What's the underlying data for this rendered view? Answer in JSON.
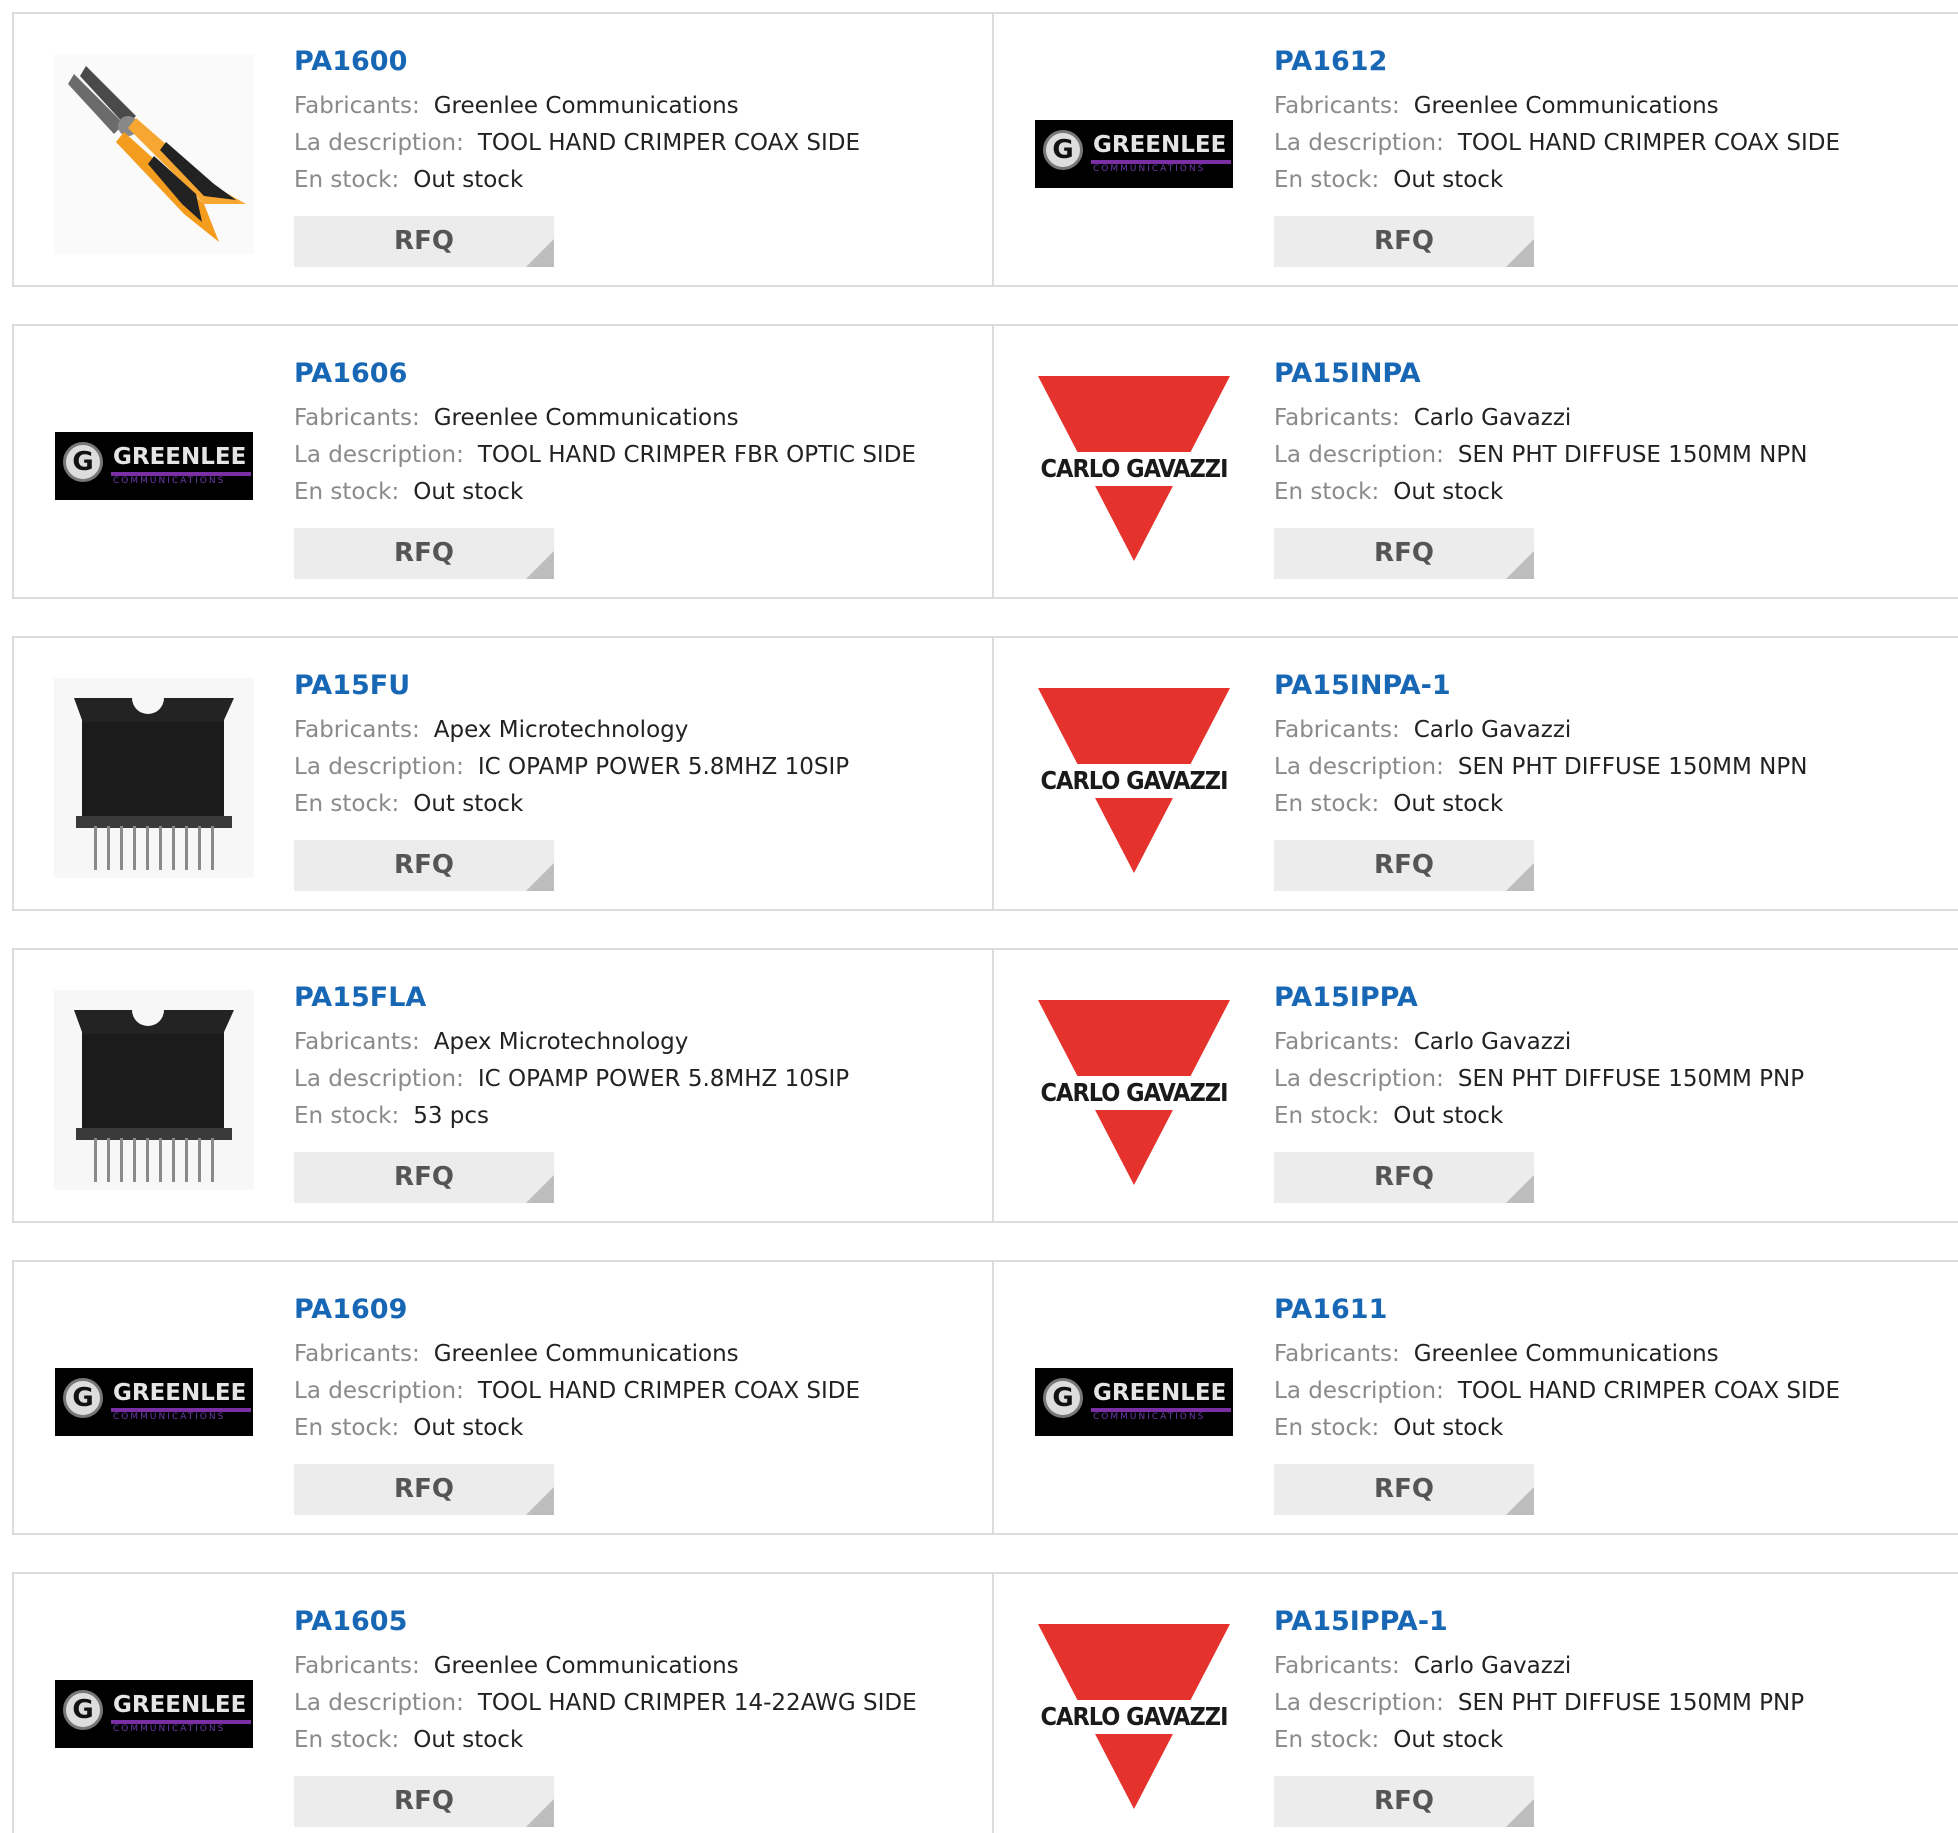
{
  "labels": {
    "manufacturer": "Fabricants:",
    "description": "La description:",
    "stock": "En stock:",
    "rfq": "RFQ"
  },
  "colors": {
    "part_link": "#1767b5",
    "border": "#dcdcdc",
    "rfq_bg": "#ececec",
    "gavazzi_red": "#e5322d"
  },
  "rows": [
    {
      "left": {
        "part": "PA1600",
        "manufacturer": "Greenlee Communications",
        "description": "TOOL HAND CRIMPER COAX SIDE",
        "stock": "Out stock",
        "image": "crimper-tool-icon"
      },
      "right": {
        "part": "PA1612",
        "manufacturer": "Greenlee Communications",
        "description": "TOOL HAND CRIMPER COAX SIDE",
        "stock": "Out stock",
        "image": "greenlee-logo"
      }
    },
    {
      "left": {
        "part": "PA1606",
        "manufacturer": "Greenlee Communications",
        "description": "TOOL HAND CRIMPER FBR OPTIC SIDE",
        "stock": "Out stock",
        "image": "greenlee-logo"
      },
      "right": {
        "part": "PA15INPA",
        "manufacturer": "Carlo Gavazzi",
        "description": "SEN PHT DIFFUSE 150MM NPN",
        "stock": "Out stock",
        "image": "carlo-gavazzi-logo"
      }
    },
    {
      "left": {
        "part": "PA15FU",
        "manufacturer": "Apex Microtechnology",
        "description": "IC OPAMP POWER 5.8MHZ 10SIP",
        "stock": "Out stock",
        "image": "ic-sip-package-icon"
      },
      "right": {
        "part": "PA15INPA-1",
        "manufacturer": "Carlo Gavazzi",
        "description": "SEN PHT DIFFUSE 150MM NPN",
        "stock": "Out stock",
        "image": "carlo-gavazzi-logo"
      }
    },
    {
      "left": {
        "part": "PA15FLA",
        "manufacturer": "Apex Microtechnology",
        "description": "IC OPAMP POWER 5.8MHZ 10SIP",
        "stock": "53 pcs",
        "image": "ic-sip-package-icon"
      },
      "right": {
        "part": "PA15IPPA",
        "manufacturer": "Carlo Gavazzi",
        "description": "SEN PHT DIFFUSE 150MM PNP",
        "stock": "Out stock",
        "image": "carlo-gavazzi-logo"
      }
    },
    {
      "left": {
        "part": "PA1609",
        "manufacturer": "Greenlee Communications",
        "description": "TOOL HAND CRIMPER COAX SIDE",
        "stock": "Out stock",
        "image": "greenlee-logo"
      },
      "right": {
        "part": "PA1611",
        "manufacturer": "Greenlee Communications",
        "description": "TOOL HAND CRIMPER COAX SIDE",
        "stock": "Out stock",
        "image": "greenlee-logo"
      }
    },
    {
      "left": {
        "part": "PA1605",
        "manufacturer": "Greenlee Communications",
        "description": "TOOL HAND CRIMPER 14-22AWG SIDE",
        "stock": "Out stock",
        "image": "greenlee-logo"
      },
      "right": {
        "part": "PA15IPPA-1",
        "manufacturer": "Carlo Gavazzi",
        "description": "SEN PHT DIFFUSE 150MM PNP",
        "stock": "Out stock",
        "image": "carlo-gavazzi-logo"
      }
    }
  ],
  "logos": {
    "greenlee_name": "GREENLEE",
    "greenlee_sub": "COMMUNICATIONS",
    "gavazzi_name": "CARLO GAVAZZI"
  }
}
